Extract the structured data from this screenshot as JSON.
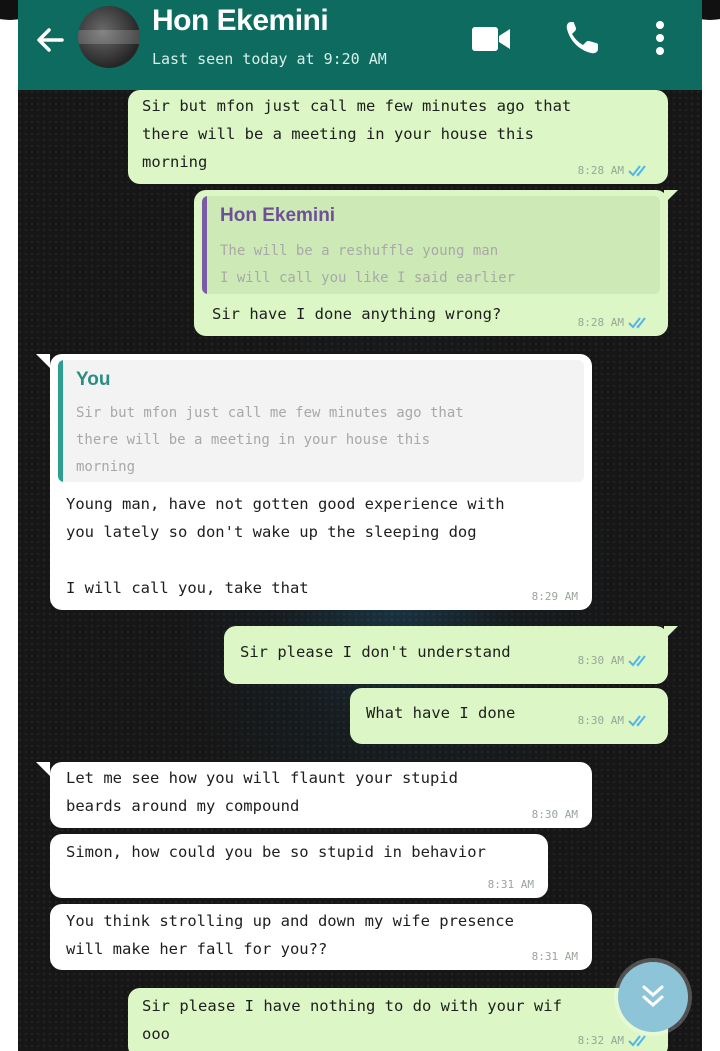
{
  "header": {
    "contact_name": "Hon Ekemini",
    "status": "Last seen today at 9:20 AM",
    "icons": [
      "back-arrow-icon",
      "video-call-icon",
      "phone-icon",
      "more-options-icon"
    ]
  },
  "colors": {
    "header_bg": "#0d6b60",
    "outgoing_bubble": "#dcf7c5",
    "incoming_bubble": "#ffffff",
    "read_ticks": "#4fb6ec"
  },
  "messages": [
    {
      "direction": "outgoing",
      "text": "Sir but mfon just call me few minutes ago that\nthere will be a meeting in your house this\nmorning",
      "time": "8:28 AM",
      "read": true
    },
    {
      "direction": "outgoing",
      "reply_to": {
        "author": "Hon Ekemini",
        "text": "The will be a reshuffle young man\nI will call you like I said earlier"
      },
      "text": "Sir have I done anything wrong?",
      "time": "8:28 AM",
      "read": true
    },
    {
      "direction": "incoming",
      "reply_to": {
        "author": "You",
        "text": "Sir but mfon just call me few minutes ago that\nthere will be a meeting in your house this\nmorning"
      },
      "text": "Young man, have not gotten good experience with\nyou lately so don't wake up the sleeping dog\n\nI will call you, take that",
      "time": "8:29 AM"
    },
    {
      "direction": "outgoing",
      "text": "Sir please I don't understand",
      "time": "8:30 AM",
      "read": true
    },
    {
      "direction": "outgoing",
      "text": "What have I done",
      "time": "8:30 AM",
      "read": true
    },
    {
      "direction": "incoming",
      "text": "Let me see how you will flaunt your stupid\nbeards around my compound",
      "time": "8:30 AM"
    },
    {
      "direction": "incoming",
      "text": "Simon, how could you be so stupid in behavior",
      "time": "8:31 AM"
    },
    {
      "direction": "incoming",
      "text": "You think strolling up and down my wife presence\nwill make her fall for you??",
      "time": "8:31 AM"
    },
    {
      "direction": "outgoing",
      "text": "Sir please I have nothing to do with your wif\nooo",
      "time": "8:32 AM",
      "read": true
    }
  ],
  "scroll_button": {
    "icon": "double-chevron-down-icon"
  }
}
